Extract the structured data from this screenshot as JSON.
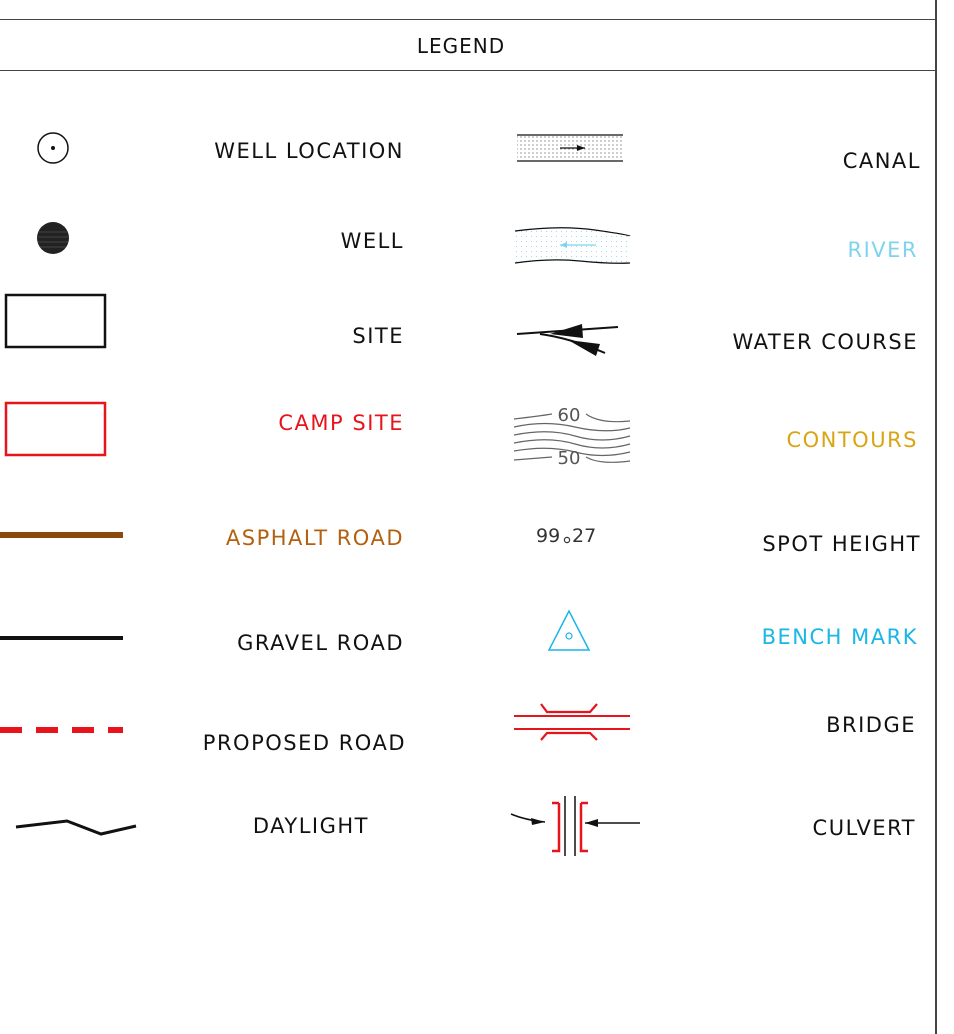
{
  "legend": {
    "title": "LEGEND"
  },
  "left_items": [
    {
      "label": "WELL LOCATION",
      "color": "#111111",
      "symbol": "well-location-icon"
    },
    {
      "label": "WELL",
      "color": "#111111",
      "symbol": "well-icon"
    },
    {
      "label": "SITE",
      "color": "#111111",
      "symbol": "site-icon"
    },
    {
      "label": "CAMP SITE",
      "color": "#e8141c",
      "symbol": "camp-site-icon"
    },
    {
      "label": "ASPHALT ROAD",
      "color": "#b3600f",
      "symbol": "asphalt-road-icon"
    },
    {
      "label": "GRAVEL ROAD",
      "color": "#111111",
      "symbol": "gravel-road-icon"
    },
    {
      "label": "PROPOSED ROAD",
      "color": "#111111",
      "symbol": "proposed-road-icon"
    },
    {
      "label": "DAYLIGHT",
      "color": "#111111",
      "symbol": "daylight-icon"
    }
  ],
  "right_items": [
    {
      "label": "CANAL",
      "color": "#111111",
      "symbol": "canal-icon"
    },
    {
      "label": "RIVER",
      "color": "#7fd3ee",
      "symbol": "river-icon"
    },
    {
      "label": "WATER COURSE",
      "color": "#111111",
      "symbol": "water-course-icon"
    },
    {
      "label": "CONTOURS",
      "color": "#d9a514",
      "symbol": "contours-icon"
    },
    {
      "label": "SPOT HEIGHT",
      "color": "#111111",
      "symbol": "spot-height-icon"
    },
    {
      "label": "BENCH MARK",
      "color": "#19b6e6",
      "symbol": "bench-mark-icon"
    },
    {
      "label": "BRIDGE",
      "color": "#111111",
      "symbol": "bridge-icon"
    },
    {
      "label": "CULVERT",
      "color": "#111111",
      "symbol": "culvert-icon"
    }
  ],
  "symbol_text": {
    "contour_upper": "60",
    "contour_lower": "50",
    "spot_height_main": "99",
    "spot_height_decimal": "27"
  },
  "colors": {
    "camp_site": "#e8141c",
    "asphalt": "#8b4a0c",
    "proposed_road": "#e8141c",
    "river": "#7fd3ee",
    "bench_mark": "#19b6e6",
    "bridge": "#e8141c",
    "culvert": "#e8141c"
  }
}
